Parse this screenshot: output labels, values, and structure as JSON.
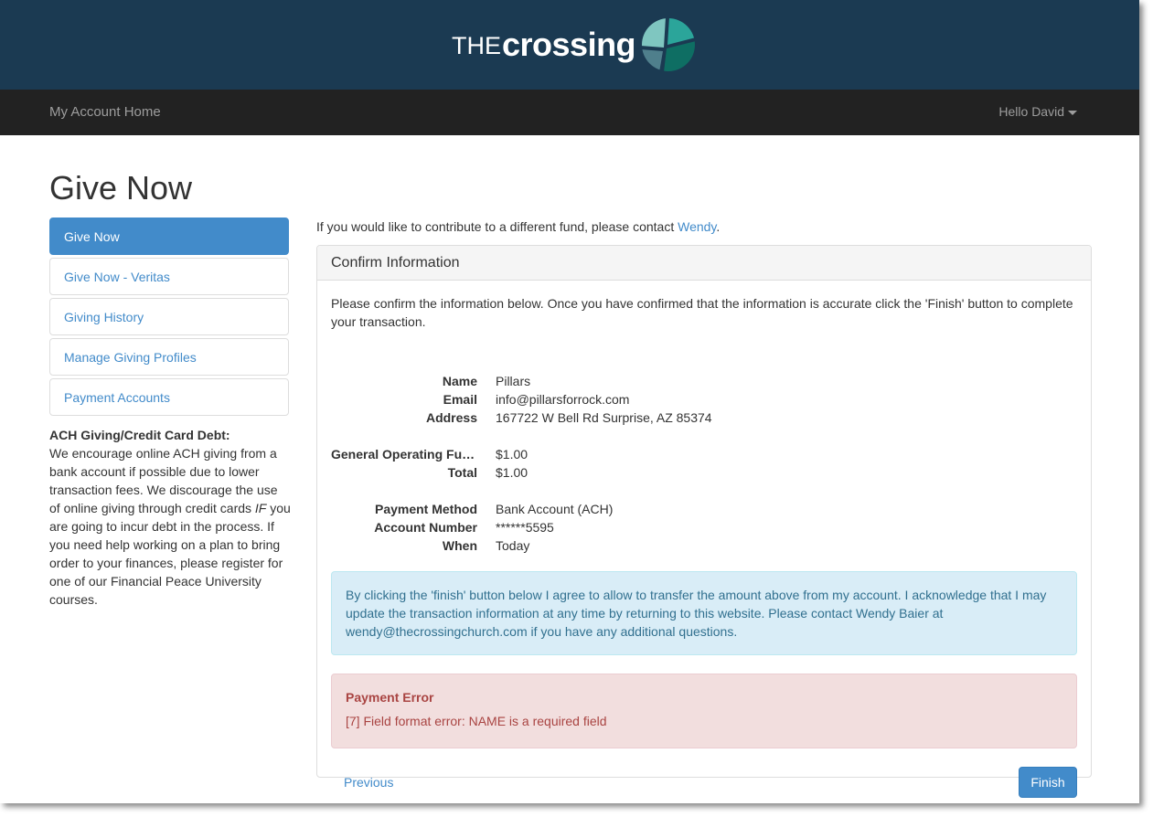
{
  "brand": {
    "logo_prefix": "THE",
    "logo_word": "crossing"
  },
  "navbar": {
    "home_link": "My Account Home",
    "user_menu": "Hello David"
  },
  "page_title": "Give Now",
  "sidebar": {
    "items": [
      {
        "label": "Give Now"
      },
      {
        "label": "Give Now - Veritas"
      },
      {
        "label": "Giving History"
      },
      {
        "label": "Manage Giving Profiles"
      },
      {
        "label": "Payment Accounts"
      }
    ],
    "note_title": "ACH Giving/Credit Card Debt:",
    "note_text_1": "We encourage online ACH giving from a bank account if possible due to lower transaction fees. We discourage the use of online giving through credit cards ",
    "note_emphasis": "IF",
    "note_text_2": " you are going to incur debt in the process. If you need help working on a plan to bring order to your finances, please register for one of our Financial Peace University courses."
  },
  "intro": {
    "text": "If you would like to contribute to a different fund, please contact ",
    "link": "Wendy",
    "suffix": "."
  },
  "panel": {
    "heading": "Confirm Information",
    "instructions": "Please confirm the information below. Once you have confirmed that the information is accurate click the 'Finish' button to complete your transaction.",
    "fields": {
      "name_label": "Name",
      "name_value": "Pillars",
      "email_label": "Email",
      "email_value": "info@pillarsforrock.com",
      "address_label": "Address",
      "address_value": "167722 W Bell Rd Surprise, AZ 85374",
      "fund_label": "General Operating Fund",
      "fund_value": "$1.00",
      "total_label": "Total",
      "total_value": "$1.00",
      "method_label": "Payment Method",
      "method_value": "Bank Account (ACH)",
      "account_label": "Account Number",
      "account_value": "******5595",
      "when_label": "When",
      "when_value": "Today"
    },
    "info_alert": "By clicking the 'finish' button below I agree to allow to transfer the amount above from my account. I acknowledge that I may update the transaction information at any time by returning to this website. Please contact Wendy Baier at wendy@thecrossingchurch.com if you have any additional questions.",
    "error_title": "Payment Error",
    "error_message": "[7] Field format error: NAME is a required field",
    "previous_label": "Previous",
    "finish_label": "Finish"
  },
  "colors": {
    "brand_bar": "#1b3a52",
    "navbar": "#222222",
    "primary": "#428bca",
    "info_bg": "#d9edf7",
    "danger_bg": "#f2dede",
    "danger_text": "#a94442"
  }
}
